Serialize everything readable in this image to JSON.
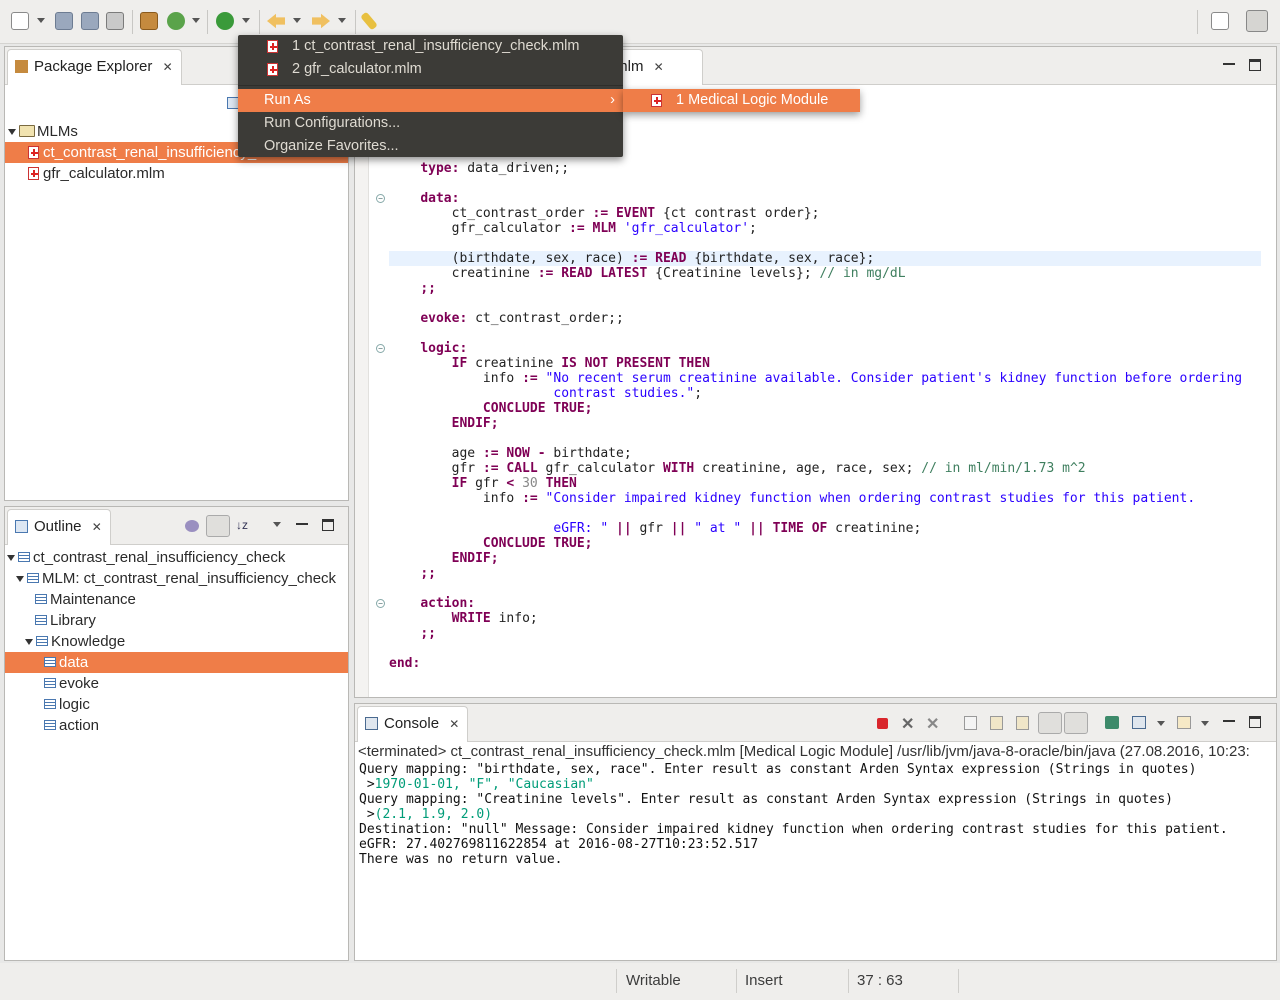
{
  "colors": {
    "selection": "#ef7d48",
    "keyword": "#7f0055",
    "string": "#2a00ff",
    "comment": "#3f7f5f",
    "menu_bg": "#3c3b37"
  },
  "toolbar": {
    "icons": [
      "new-wizard-icon",
      "save-icon",
      "save-all-icon",
      "print-icon",
      "package-icon",
      "refresh-icon",
      "run-icon",
      "back-icon",
      "forward-icon",
      "annotation-icon",
      "open-perspective-icon",
      "java-perspective-icon"
    ]
  },
  "package_explorer": {
    "title": "Package Explorer",
    "root": "MLMs",
    "items": [
      "ct_contrast_renal_insufficiency_check.mlm",
      "gfr_calculator.mlm"
    ]
  },
  "outline": {
    "title": "Outline",
    "root": "ct_contrast_renal_insufficiency_check",
    "mlm": "MLM: ct_contrast_renal_insufficiency_check",
    "maintenance": "Maintenance",
    "library": "Library",
    "knowledge": "Knowledge",
    "children": [
      "data",
      "evoke",
      "logic",
      "action"
    ]
  },
  "editor": {
    "tab": "ck.mlm"
  },
  "run_menu": {
    "recent1": "1 ct_contrast_renal_insufficiency_check.mlm",
    "recent2": "2 gfr_calculator.mlm",
    "run_as": "Run As",
    "run_configs": "Run Configurations...",
    "organize": "Organize Favorites...",
    "submenu_item": "1 Medical Logic Module"
  },
  "console": {
    "title": "Console",
    "header": "<terminated> ct_contrast_renal_insufficiency_check.mlm [Medical Logic Module] /usr/lib/jvm/java-8-oracle/bin/java (27.08.2016, 10:23:",
    "lines": [
      {
        "text": "Query mapping: \"birthdate, sex, race\". Enter result as constant Arden Syntax expression (Strings in quotes)",
        "kind": "out"
      },
      {
        "text": " >",
        "kind": "out",
        "input": "1970-01-01, \"F\", \"Caucasian\""
      },
      {
        "text": "Query mapping: \"Creatinine levels\". Enter result as constant Arden Syntax expression (Strings in quotes)",
        "kind": "out"
      },
      {
        "text": " >",
        "kind": "out",
        "input": "(2.1, 1.9, 2.0)"
      },
      {
        "text": "Destination: \"null\" Message: Consider impaired kidney function when ordering contrast studies for this patient.",
        "kind": "out"
      },
      {
        "text": "eGFR: 27.402769811622854 at 2016-08-27T10:23:52.517",
        "kind": "out"
      },
      {
        "text": "There was no return value.",
        "kind": "out"
      }
    ]
  },
  "status_bar": {
    "writable": "Writable",
    "insert": "Insert",
    "position": "37 : 63"
  }
}
